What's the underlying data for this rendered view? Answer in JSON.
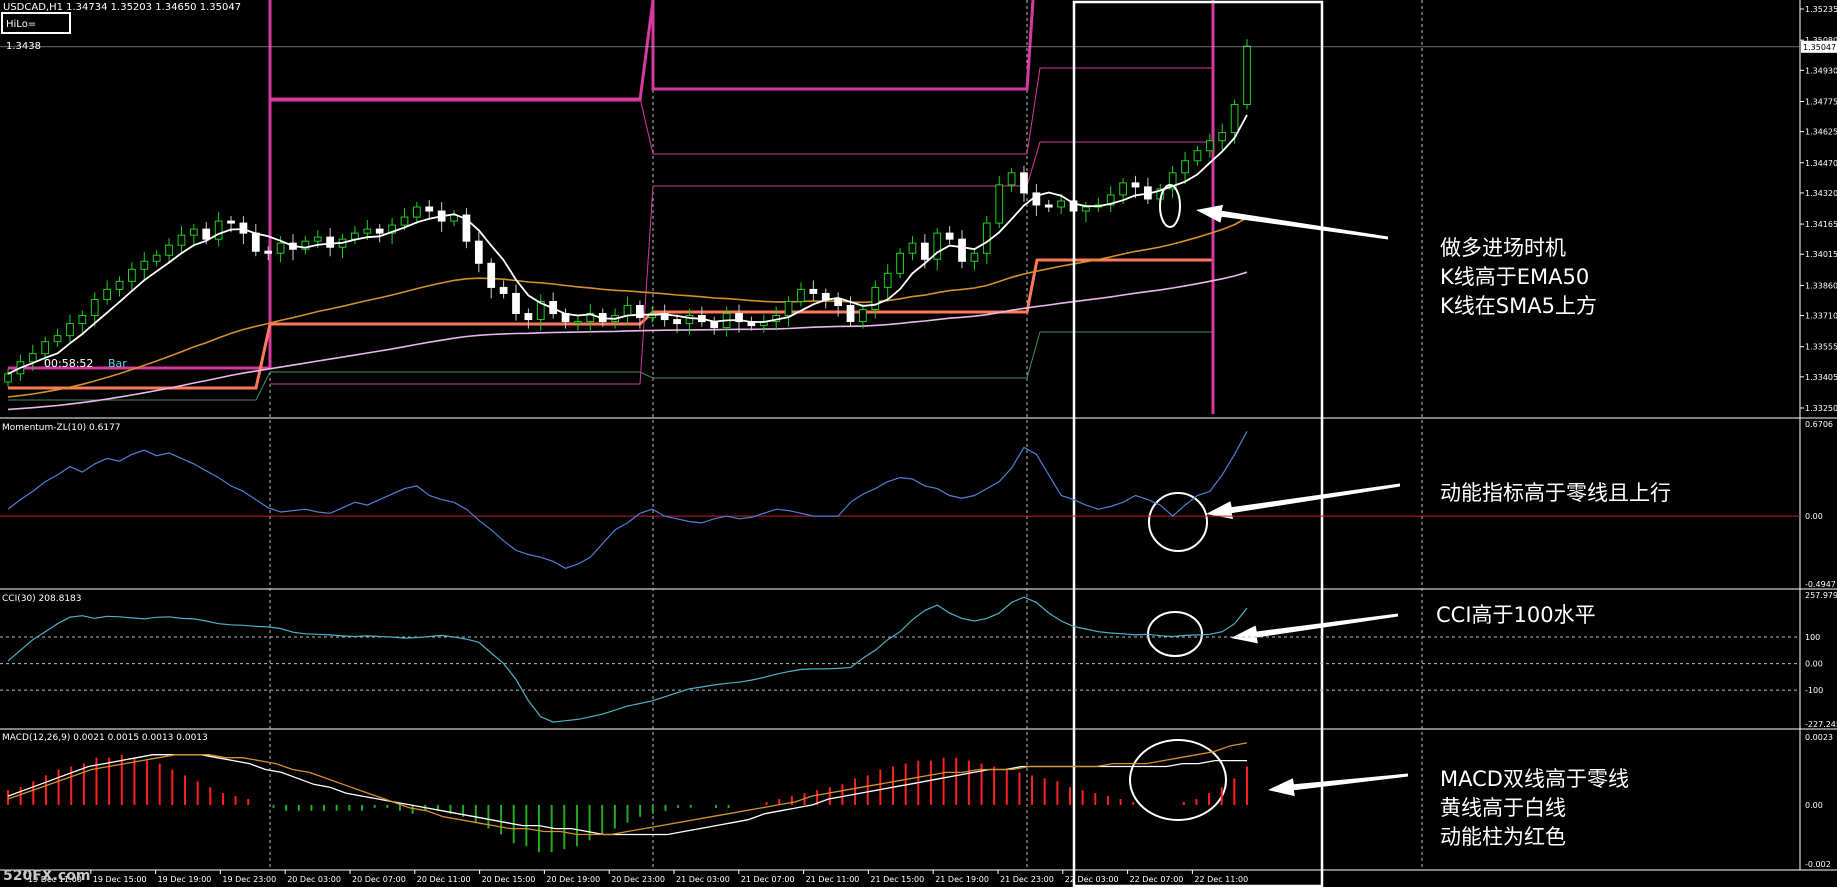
{
  "header": {
    "title": "USDCAD,H1  1.34734 1.35203 1.34650 1.35047",
    "hilo_label": "HiLo= 1.3438",
    "clock": "00:58:52",
    "bar_label": "Bar"
  },
  "watermark": "520FX.com",
  "annotations": {
    "price": [
      "做多进场时机",
      "K线高于EMA50",
      "K线在SMA5上方"
    ],
    "momentum": [
      "动能指标高于零线且上行"
    ],
    "cci": [
      "CCI高于100水平"
    ],
    "macd": [
      "MACD双线高于零线",
      "黄线高于白线",
      "动能柱为红色"
    ]
  },
  "colors": {
    "background": "#000000",
    "bull_candle": "#1fd01f",
    "bear_candle": "#ffffff",
    "sma5": "#ffffff",
    "ema50": "#d4902a",
    "slow_ma": "#e8b8e8",
    "hilo_band": "#d63aa0",
    "hilo_mid": "#ff7a5a",
    "hilo_low": "#3f8f5f",
    "momentum": "#4f7fd8",
    "cci": "#4fb0c8",
    "macd_line": "#ffffff",
    "signal_line": "#d4902a",
    "hist_pos": "#ff2020",
    "hist_neg": "#22aa22",
    "zero_line": "#c02020"
  },
  "chart_data": [
    {
      "type": "candlestick",
      "panel": "price",
      "title": "USDCAD,H1",
      "ohlc_last": {
        "open": 1.34734,
        "high": 1.35203,
        "low": 1.3465,
        "close": 1.35047
      },
      "current_price_label": "1.35047",
      "ylim": [
        1.3325,
        1.3525
      ],
      "y_ticks": [
        "1.35235",
        "1.35080",
        "1.34930",
        "1.34775",
        "1.34625",
        "1.34470",
        "1.34320",
        "1.34165",
        "1.34015",
        "1.33860",
        "1.33710",
        "1.33555",
        "1.33405",
        "1.33250"
      ],
      "x_ticks": [
        "19 Dec 11:00",
        "19 Dec 15:00",
        "19 Dec 19:00",
        "19 Dec 23:00",
        "20 Dec 03:00",
        "20 Dec 07:00",
        "20 Dec 11:00",
        "20 Dec 15:00",
        "20 Dec 19:00",
        "20 Dec 23:00",
        "21 Dec 03:00",
        "21 Dec 07:00",
        "21 Dec 11:00",
        "21 Dec 15:00",
        "21 Dec 19:00",
        "21 Dec 23:00",
        "22 Dec 03:00",
        "22 Dec 07:00",
        "22 Dec 11:00"
      ],
      "closes": [
        1.3342,
        1.3348,
        1.3352,
        1.3358,
        1.3361,
        1.3367,
        1.3371,
        1.3379,
        1.3384,
        1.3388,
        1.3394,
        1.3398,
        1.3401,
        1.3406,
        1.3411,
        1.3414,
        1.3409,
        1.3418,
        1.3417,
        1.3412,
        1.3403,
        1.3402,
        1.3407,
        1.3404,
        1.3408,
        1.341,
        1.3405,
        1.3409,
        1.3412,
        1.3414,
        1.3412,
        1.3416,
        1.342,
        1.3425,
        1.3423,
        1.3418,
        1.3421,
        1.3408,
        1.3397,
        1.3385,
        1.3382,
        1.3372,
        1.3369,
        1.3378,
        1.3372,
        1.3368,
        1.3368,
        1.3372,
        1.3368,
        1.3371,
        1.3376,
        1.337,
        1.3372,
        1.3369,
        1.3367,
        1.3371,
        1.3368,
        1.3365,
        1.3372,
        1.3368,
        1.3366,
        1.3368,
        1.3371,
        1.3378,
        1.3384,
        1.3382,
        1.3379,
        1.3376,
        1.3368,
        1.3374,
        1.3385,
        1.3392,
        1.3402,
        1.3407,
        1.3399,
        1.3412,
        1.3409,
        1.3398,
        1.3402,
        1.3417,
        1.3436,
        1.3442,
        1.3432,
        1.3426,
        1.3425,
        1.3428,
        1.3423,
        1.3425,
        1.3426,
        1.3431,
        1.3437,
        1.3435,
        1.3429,
        1.3434,
        1.3442,
        1.3448,
        1.3453,
        1.3458,
        1.3462,
        1.3476,
        1.3505
      ],
      "series": [
        {
          "name": "SMA5",
          "color": "#ffffff"
        },
        {
          "name": "EMA50",
          "color": "#d4902a"
        }
      ]
    },
    {
      "type": "line",
      "panel": "momentum",
      "title": "Momentum-ZL(10) 0.6177",
      "ylim": [
        -0.4947,
        0.6706
      ],
      "y_ticks": [
        "0.6706",
        "0.00",
        "-0.4947"
      ],
      "zero": 0.0,
      "values": [
        0.05,
        0.12,
        0.18,
        0.25,
        0.3,
        0.36,
        0.32,
        0.38,
        0.42,
        0.4,
        0.45,
        0.48,
        0.44,
        0.46,
        0.42,
        0.38,
        0.33,
        0.28,
        0.22,
        0.18,
        0.12,
        0.06,
        0.03,
        0.04,
        0.05,
        0.03,
        0.02,
        0.06,
        0.1,
        0.08,
        0.12,
        0.16,
        0.2,
        0.22,
        0.15,
        0.12,
        0.1,
        0.05,
        -0.03,
        -0.1,
        -0.18,
        -0.25,
        -0.28,
        -0.3,
        -0.33,
        -0.38,
        -0.35,
        -0.3,
        -0.2,
        -0.1,
        -0.05,
        0.02,
        0.05,
        0.0,
        -0.02,
        -0.04,
        -0.05,
        -0.02,
        0.0,
        -0.02,
        -0.01,
        0.02,
        0.05,
        0.04,
        0.02,
        0.0,
        0.0,
        0.0,
        0.1,
        0.16,
        0.2,
        0.25,
        0.28,
        0.27,
        0.22,
        0.2,
        0.15,
        0.13,
        0.15,
        0.2,
        0.25,
        0.35,
        0.5,
        0.45,
        0.3,
        0.15,
        0.12,
        0.08,
        0.05,
        0.07,
        0.1,
        0.15,
        0.12,
        0.08,
        0.0,
        0.08,
        0.15,
        0.18,
        0.3,
        0.45,
        0.6177
      ]
    },
    {
      "type": "line",
      "panel": "cci",
      "title": "CCI(30) 208.8183",
      "ylim": [
        -227.2455,
        257.9794
      ],
      "y_ticks": [
        "257.9794",
        "100",
        "0.00",
        "-100",
        "-227.2455"
      ],
      "levels": [
        100,
        0,
        -100
      ],
      "values": [
        10,
        50,
        90,
        120,
        150,
        175,
        180,
        170,
        178,
        176,
        172,
        168,
        174,
        176,
        170,
        168,
        160,
        150,
        146,
        144,
        140,
        138,
        132,
        118,
        112,
        110,
        108,
        104,
        102,
        104,
        102,
        100,
        96,
        98,
        102,
        106,
        100,
        92,
        80,
        40,
        0,
        -60,
        -140,
        -200,
        -220,
        -215,
        -210,
        -200,
        -190,
        -175,
        -160,
        -150,
        -140,
        -125,
        -110,
        -95,
        -88,
        -80,
        -74,
        -70,
        -62,
        -52,
        -40,
        -30,
        -22,
        -20,
        -20,
        -18,
        -15,
        20,
        50,
        90,
        120,
        165,
        200,
        220,
        190,
        170,
        160,
        170,
        190,
        230,
        250,
        230,
        190,
        160,
        140,
        130,
        120,
        115,
        112,
        108,
        110,
        105,
        102,
        106,
        108,
        110,
        120,
        150,
        208.8183
      ]
    },
    {
      "type": "bar+line",
      "panel": "macd",
      "title": "MACD(12,26,9) 0.0021 0.0015 0.0013 0.0013",
      "ylim": [
        -0.002,
        0.0023
      ],
      "y_ticks": [
        "0.0023",
        "0.00",
        "-0.002"
      ],
      "histogram": [
        0.0005,
        0.0006,
        0.0008,
        0.001,
        0.0012,
        0.0013,
        0.0014,
        0.0016,
        0.0016,
        0.0017,
        0.0016,
        0.0015,
        0.0014,
        0.0012,
        0.001,
        0.0008,
        0.0006,
        0.0004,
        0.0003,
        0.0002,
        0.0,
        -0.0001,
        -0.0002,
        -0.0002,
        -0.0002,
        -0.0002,
        -0.0002,
        -0.0002,
        -0.0002,
        -0.0001,
        -0.0001,
        -0.0002,
        -0.0003,
        -0.0002,
        -0.0002,
        -0.0003,
        -0.0004,
        -0.0006,
        -0.0008,
        -0.001,
        -0.0013,
        -0.0014,
        -0.0016,
        -0.0016,
        -0.0015,
        -0.0014,
        -0.0012,
        -0.001,
        -0.0008,
        -0.0006,
        -0.0004,
        -0.0003,
        -0.0002,
        -0.0001,
        -0.0001,
        0.0,
        -0.0001,
        -0.0001,
        0.0,
        0.0,
        0.0001,
        0.0002,
        0.0003,
        0.0004,
        0.0005,
        0.0006,
        0.0007,
        0.0009,
        0.001,
        0.0012,
        0.0013,
        0.0014,
        0.0015,
        0.0015,
        0.0016,
        0.0016,
        0.0015,
        0.0014,
        0.0013,
        0.0012,
        0.0011,
        0.001,
        0.0009,
        0.0008,
        0.0006,
        0.0005,
        0.0004,
        0.0003,
        0.0002,
        0.0001,
        0.0,
        0.0,
        0.0,
        0.0001,
        0.0002,
        0.0004,
        0.0006,
        0.0009,
        0.0013
      ],
      "series": [
        {
          "name": "MACD",
          "color": "#ffffff",
          "values": [
            0.0003,
            0.0005,
            0.0007,
            0.0009,
            0.0011,
            0.0013,
            0.0014,
            0.0015,
            0.0016,
            0.0017,
            0.0017,
            0.0017,
            0.0017,
            0.0016,
            0.0015,
            0.0014,
            0.0012,
            0.0011,
            0.0009,
            0.0007,
            0.0006,
            0.0004,
            0.0003,
            0.0002,
            0.0001,
            0.0,
            -0.0001,
            -0.0002,
            -0.0003,
            -0.0004,
            -0.0005,
            -0.0006,
            -0.0007,
            -0.0007,
            -0.0008,
            -0.0008,
            -0.0009,
            -0.001,
            -0.001,
            -0.001,
            -0.001,
            -0.001,
            -0.0009,
            -0.0008,
            -0.0007,
            -0.0006,
            -0.0005,
            -0.0003,
            -0.0002,
            -0.0001,
            0.0,
            0.0002,
            0.0003,
            0.0004,
            0.0005,
            0.0006,
            0.0007,
            0.0008,
            0.0009,
            0.001,
            0.0011,
            0.0012,
            0.0012,
            0.0013,
            0.0013,
            0.0013,
            0.0013,
            0.0013,
            0.0013,
            0.0013,
            0.0013,
            0.0013,
            0.0013,
            0.0014,
            0.0014,
            0.0015,
            0.0015,
            0.0015
          ]
        },
        {
          "name": "Signal",
          "color": "#d4902a",
          "values": [
            0.0002,
            0.0004,
            0.0006,
            0.0008,
            0.001,
            0.0012,
            0.0013,
            0.0014,
            0.0015,
            0.0016,
            0.0017,
            0.0017,
            0.0017,
            0.0016,
            0.0016,
            0.0015,
            0.0014,
            0.0012,
            0.0011,
            0.0009,
            0.0007,
            0.0005,
            0.0003,
            0.0001,
            -0.0001,
            -0.0002,
            -0.0004,
            -0.0005,
            -0.0006,
            -0.0007,
            -0.0008,
            -0.0008,
            -0.0009,
            -0.0009,
            -0.001,
            -0.001,
            -0.001,
            -0.0009,
            -0.0008,
            -0.0007,
            -0.0006,
            -0.0005,
            -0.0004,
            -0.0003,
            -0.0002,
            -0.0001,
            0.0,
            0.0001,
            0.0003,
            0.0004,
            0.0005,
            0.0006,
            0.0007,
            0.0008,
            0.0009,
            0.001,
            0.0011,
            0.0011,
            0.0012,
            0.0012,
            0.0012,
            0.0013,
            0.0013,
            0.0013,
            0.0013,
            0.0013,
            0.0014,
            0.0014,
            0.0014,
            0.0015,
            0.0016,
            0.0017,
            0.0018,
            0.002,
            0.0021
          ]
        }
      ]
    }
  ]
}
